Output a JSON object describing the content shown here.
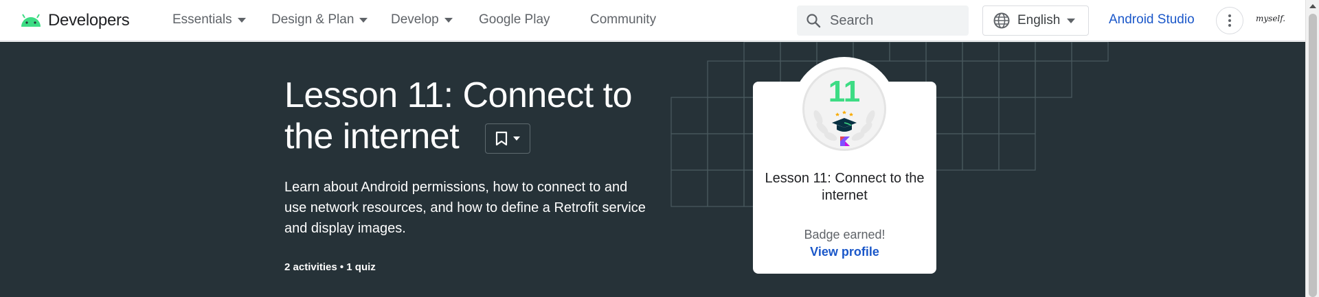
{
  "header": {
    "logo_text": "Developers",
    "nav": [
      {
        "label": "Essentials",
        "has_menu": true
      },
      {
        "label": "Design & Plan",
        "has_menu": true
      },
      {
        "label": "Develop",
        "has_menu": true
      },
      {
        "label": "Google Play",
        "has_menu": false
      },
      {
        "label": "Community",
        "has_menu": false
      }
    ],
    "search": {
      "placeholder": "Search",
      "value": ""
    },
    "language": "English",
    "studio_link": "Android Studio",
    "avatar_text": "myself."
  },
  "hero": {
    "title": "Lesson 11: Connect to the internet",
    "description": "Learn about Android permissions, how to connect to and use network resources, and how to define a Retrofit service and display images.",
    "meta": "2 activities • 1 quiz"
  },
  "badge_card": {
    "number": "11",
    "title": "Lesson 11: Connect to the internet",
    "status": "Badge earned!",
    "link": "View profile"
  },
  "colors": {
    "hero_bg": "#263238",
    "accent_green": "#3ddc84",
    "link_blue": "#1a57c9"
  },
  "icons": [
    "android-logo-icon",
    "search-icon",
    "globe-icon",
    "bookmark-icon",
    "more-vert-icon",
    "graduation-cap-icon",
    "kotlin-icon"
  ]
}
